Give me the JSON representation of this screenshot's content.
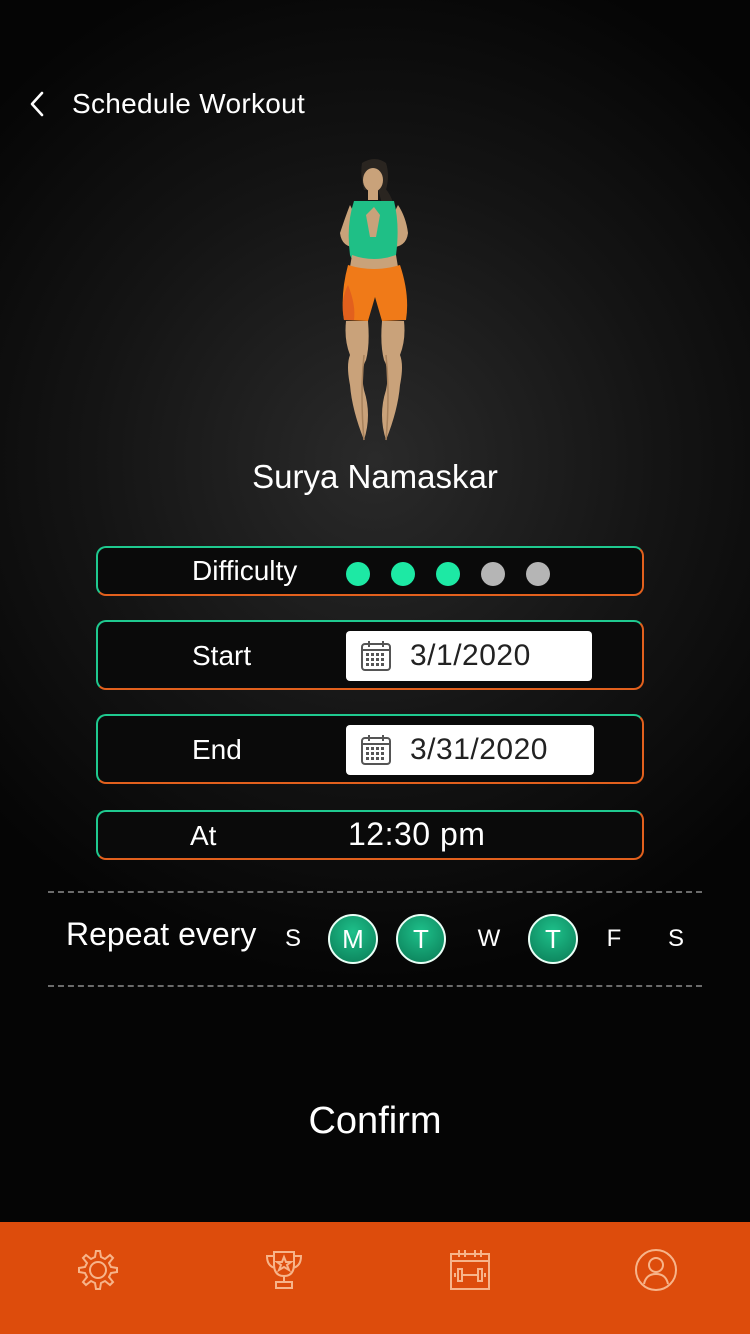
{
  "header": {
    "title": "Schedule Workout",
    "back_icon": "chevron-left-icon"
  },
  "workout": {
    "name": "Surya Namaskar",
    "illustration": "yoga-pose-figure"
  },
  "difficulty": {
    "label": "Difficulty",
    "level": 3,
    "max": 5,
    "active_color": "#1de9a4",
    "inactive_color": "#b5b5b5"
  },
  "start": {
    "label": "Start",
    "date": "3/1/2020",
    "icon": "calendar-icon"
  },
  "end": {
    "label": "End",
    "date": "3/31/2020",
    "icon": "calendar-icon"
  },
  "at": {
    "label": "At",
    "time": "12:30 pm"
  },
  "repeat": {
    "label": "Repeat every",
    "days": [
      {
        "letter": "S",
        "selected": false
      },
      {
        "letter": "M",
        "selected": true
      },
      {
        "letter": "T",
        "selected": true
      },
      {
        "letter": "W",
        "selected": false
      },
      {
        "letter": "T",
        "selected": true
      },
      {
        "letter": "F",
        "selected": false
      },
      {
        "letter": "S",
        "selected": false
      }
    ]
  },
  "confirm_label": "Confirm",
  "tabbar": {
    "color": "#dd4c0c",
    "items": [
      "gear-icon",
      "trophy-icon",
      "workout-calendar-icon",
      "profile-icon"
    ]
  },
  "colors": {
    "accent_green": "#1fc98f",
    "accent_orange": "#e2601d"
  }
}
